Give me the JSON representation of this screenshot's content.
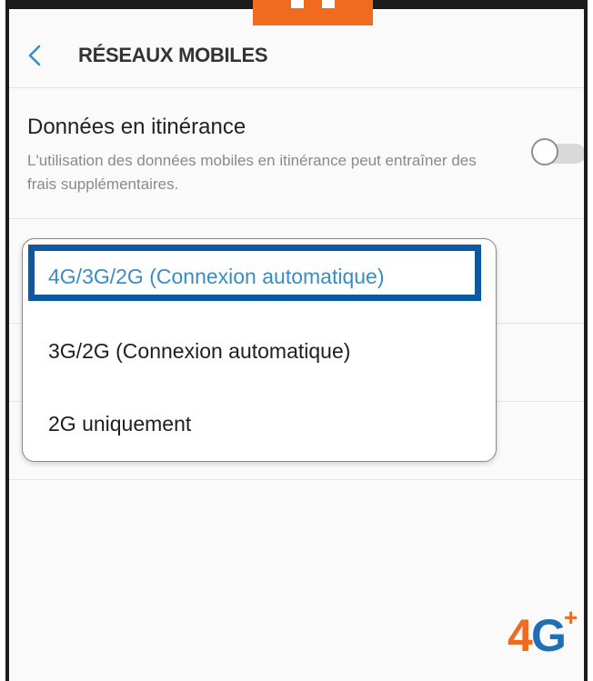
{
  "header": {
    "back_icon": "chevron-left-icon",
    "title": "RÉSEAUX MOBILES"
  },
  "roaming": {
    "title": "Données en itinérance",
    "description": "L'utilisation des données mobiles en itinérance peut entraîner des frais supplémentaires.",
    "toggle_state": "off"
  },
  "network_mode_dropdown": {
    "options": [
      {
        "label": "4G/3G/2G (Connexion automatique)",
        "selected": true
      },
      {
        "label": "3G/2G (Connexion automatique)",
        "selected": false
      },
      {
        "label": "2G uniquement",
        "selected": false
      }
    ]
  },
  "logo": {
    "text_main_1": "4",
    "text_main_2": "G",
    "text_sup": "+"
  },
  "colors": {
    "accent_blue": "#3a8dc4",
    "highlight_border": "#0b5aa1",
    "brand_orange": "#f06a1f",
    "brand_blue": "#1f6fb5"
  }
}
